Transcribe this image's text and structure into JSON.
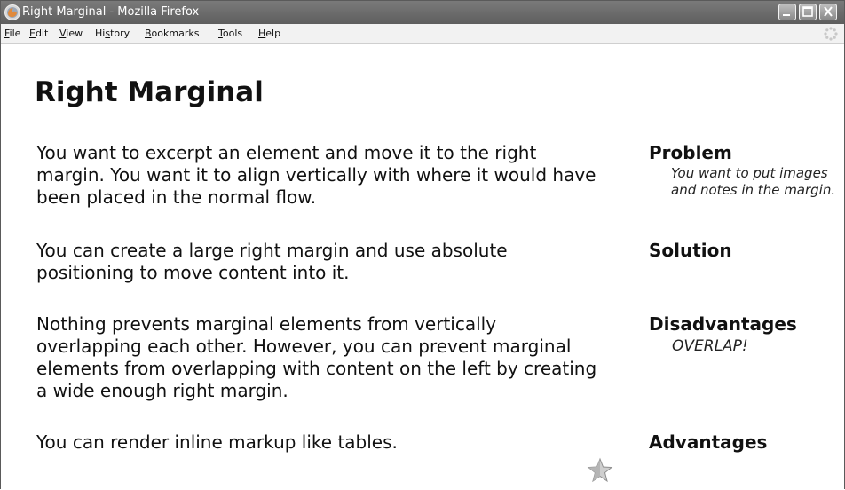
{
  "window": {
    "title": "Right Marginal - Mozilla Firefox"
  },
  "menu": {
    "items": [
      {
        "accel": "F",
        "rest": "ile"
      },
      {
        "accel": "E",
        "rest": "dit"
      },
      {
        "accel": "V",
        "rest": "iew"
      },
      {
        "accel": "",
        "rest": "Hi",
        "accel2": "s",
        "rest2": "tory"
      },
      {
        "accel": "B",
        "rest": "ookmarks"
      },
      {
        "accel": "T",
        "rest": "ools"
      },
      {
        "accel": "H",
        "rest": "elp"
      }
    ]
  },
  "page": {
    "title": "Right Marginal",
    "paragraphs": [
      "You want to excerpt an element and move it to the right margin. You want it to align vertically with where it would have been placed in the normal flow.",
      "You can create a large right margin and use absolute positioning to move content into it.",
      "Nothing prevents marginal elements from vertically overlapping each other. However, you can prevent marginal elements from overlapping with content on the left by creating a wide enough right margin.",
      "You can render inline markup like tables."
    ],
    "margin": {
      "problem_heading": "Problem",
      "problem_note": "You want to put images and notes in the margin.",
      "solution_heading": "Solution",
      "disadvantages_heading": "Disadvantages",
      "disadvantages_note": "OVERLAP!",
      "advantages_heading": "Advantages"
    }
  },
  "icons": {
    "app": "firefox-icon",
    "minimize": "minimize-icon",
    "maximize": "maximize-icon",
    "close": "close-icon",
    "throbber": "throbber-icon",
    "star": "star-icon"
  }
}
